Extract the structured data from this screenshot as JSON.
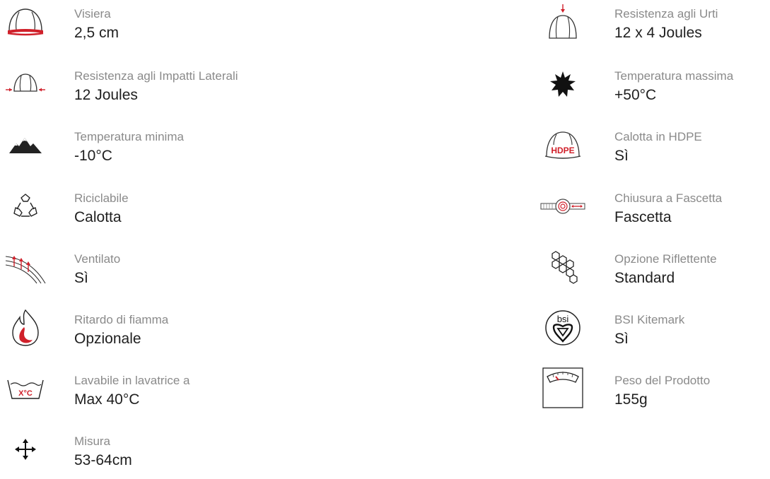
{
  "left_features": [
    {
      "icon": "helmet-visor-icon",
      "label": "Visiera",
      "value": "2,5 cm"
    },
    {
      "icon": "lateral-impact-icon",
      "label": "Resistenza agli Impatti Laterali",
      "value": "12 Joules"
    },
    {
      "icon": "mountains-icon",
      "label": "Temperatura minima",
      "value": "-10°C"
    },
    {
      "icon": "recycle-icon",
      "label": "Riciclabile",
      "value": "Calotta"
    },
    {
      "icon": "ventilation-icon",
      "label": "Ventilato",
      "value": "Sì"
    },
    {
      "icon": "flame-icon",
      "label": "Ritardo di fiamma",
      "value": "Opzionale"
    },
    {
      "icon": "wash-icon",
      "label": "Lavabile in lavatrice a",
      "value": "Max 40°C",
      "icon_text": "X°C"
    },
    {
      "icon": "size-arrows-icon",
      "label": "Misura",
      "value": "53-64cm"
    }
  ],
  "right_features": [
    {
      "icon": "top-impact-icon",
      "label": "Resistenza agli Urti",
      "value": "12 x 4 Joules"
    },
    {
      "icon": "sun-icon",
      "label": "Temperatura massima",
      "value": "+50°C"
    },
    {
      "icon": "hdpe-helmet-icon",
      "label": "Calotta in HDPE",
      "value": "Sì",
      "icon_text": "HDPE"
    },
    {
      "icon": "strap-closure-icon",
      "label": "Chiusura a Fascetta",
      "value": "Fascetta"
    },
    {
      "icon": "hexagons-icon",
      "label": "Opzione Riflettente",
      "value": "Standard"
    },
    {
      "icon": "bsi-kitemark-icon",
      "label": "BSI Kitemark",
      "value": "Sì",
      "icon_text": "bsi"
    },
    {
      "icon": "scale-icon",
      "label": "Peso del Prodotto",
      "value": "155g"
    }
  ],
  "colors": {
    "accent": "#d0202a",
    "label": "#8a8a8a",
    "value": "#1f1f1f",
    "icon": "#333333"
  }
}
